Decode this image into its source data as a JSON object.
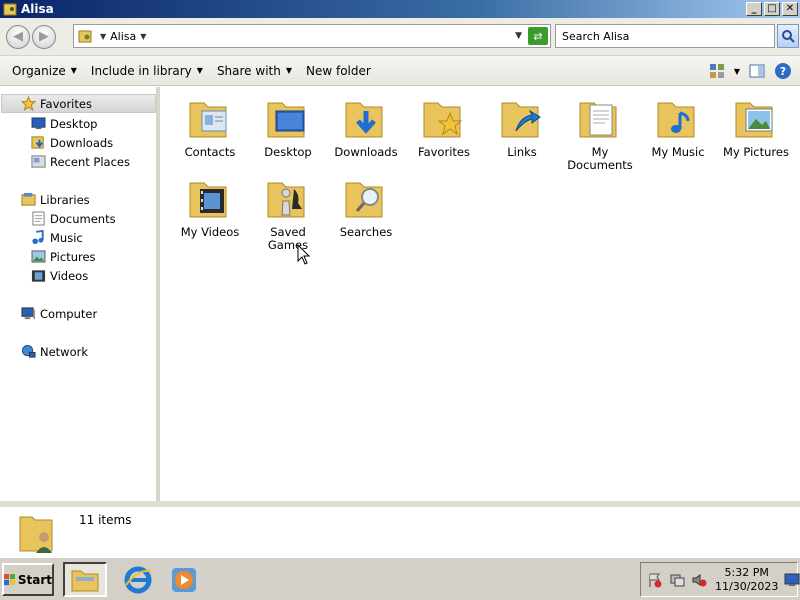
{
  "window": {
    "title": "Alisa",
    "minimize": "_",
    "restore": "□",
    "close": "✕"
  },
  "address": {
    "crumb": "Alisa",
    "search_placeholder": "Search Alisa"
  },
  "commands": {
    "organize": "Organize",
    "include_in_library": "Include in library",
    "share_with": "Share with",
    "new_folder": "New folder"
  },
  "nav": {
    "favorites": "Favorites",
    "desktop": "Desktop",
    "downloads": "Downloads",
    "recent_places": "Recent Places",
    "libraries": "Libraries",
    "documents": "Documents",
    "music": "Music",
    "pictures": "Pictures",
    "videos": "Videos",
    "computer": "Computer",
    "network": "Network"
  },
  "folders": [
    {
      "label": "Contacts",
      "icon": "contacts-icon"
    },
    {
      "label": "Desktop",
      "icon": "desktop-icon"
    },
    {
      "label": "Downloads",
      "icon": "downloads-icon"
    },
    {
      "label": "Favorites",
      "icon": "favorites-icon"
    },
    {
      "label": "Links",
      "icon": "links-icon"
    },
    {
      "label": "My Documents",
      "icon": "documents-icon"
    },
    {
      "label": "My Music",
      "icon": "music-icon"
    },
    {
      "label": "My Pictures",
      "icon": "pictures-icon"
    },
    {
      "label": "My Videos",
      "icon": "videos-icon"
    },
    {
      "label": "Saved Games",
      "icon": "saved-games-icon"
    },
    {
      "label": "Searches",
      "icon": "searches-icon"
    }
  ],
  "details": {
    "count": "11 items"
  },
  "taskbar": {
    "start": "Start",
    "time": "5:32 PM",
    "date": "11/30/2023"
  }
}
